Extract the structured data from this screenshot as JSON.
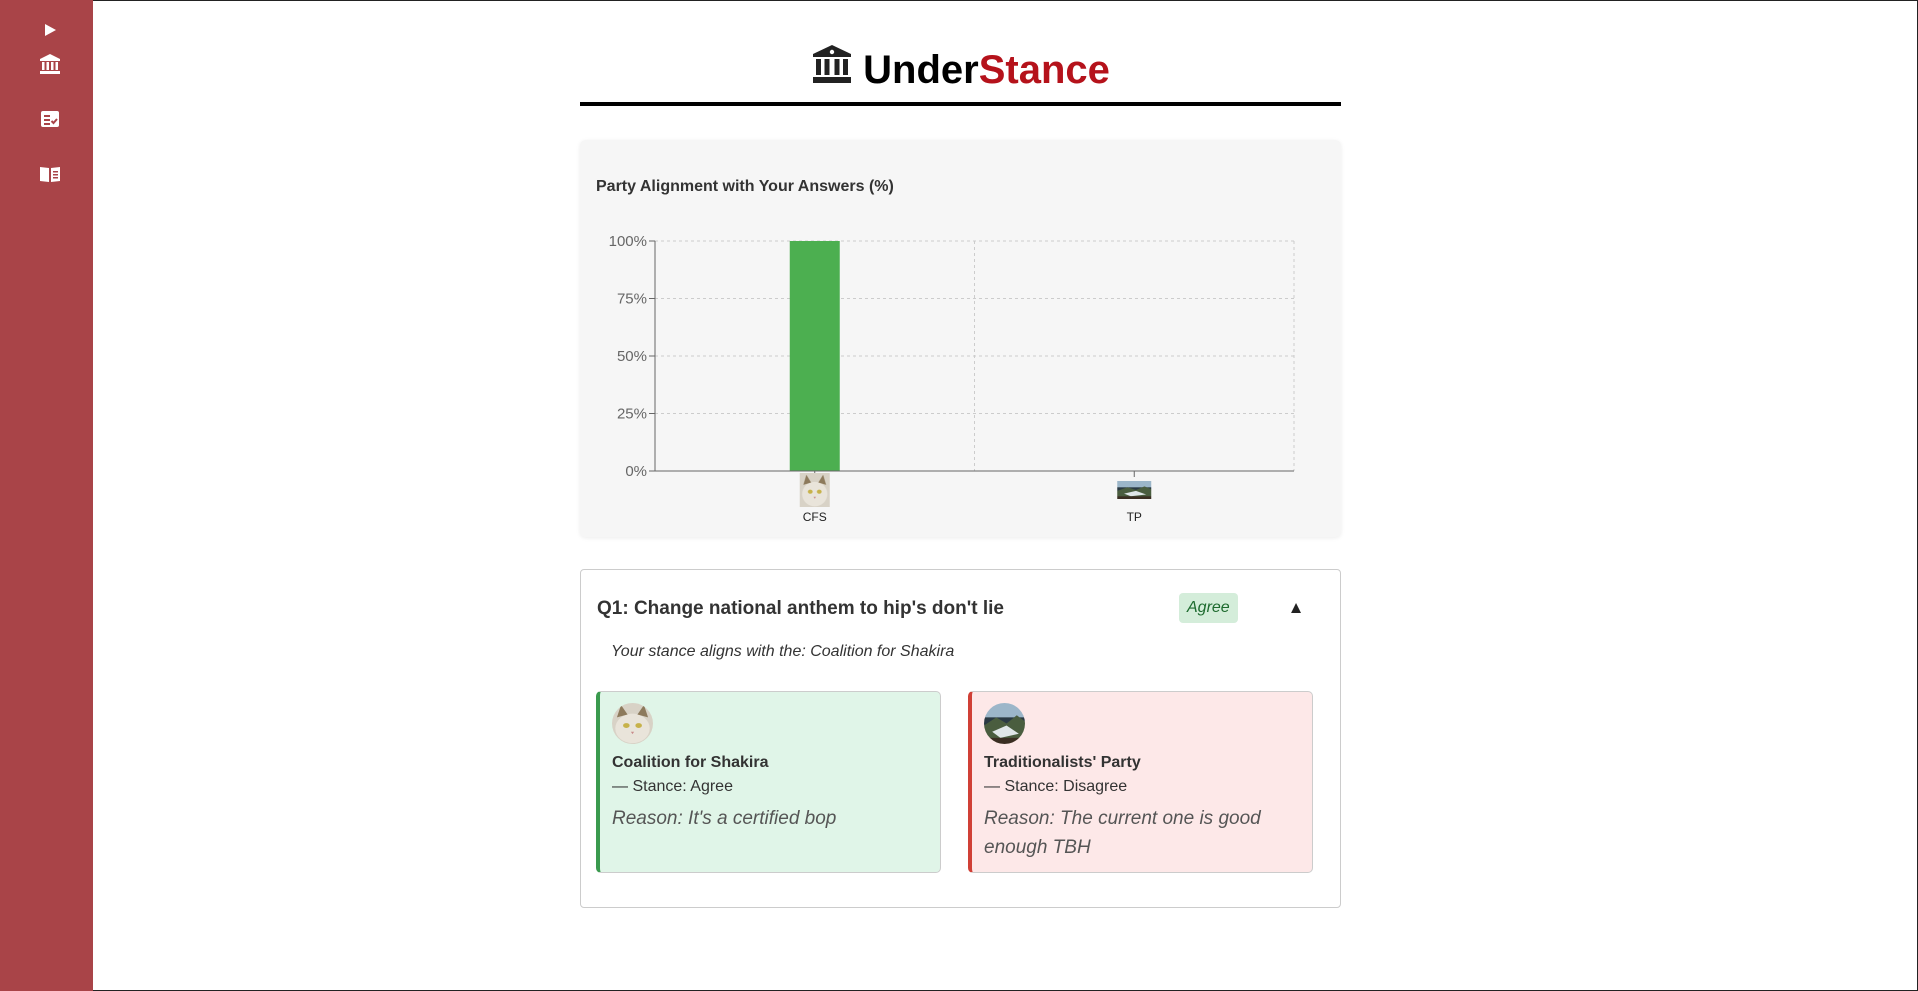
{
  "app": {
    "brand_part1": "Under",
    "brand_part2": "Stance",
    "logo_icon": "landmark-icon",
    "brand_colors": {
      "part1": "#000000",
      "part2": "#b5121b",
      "sidebar": "#a94448"
    }
  },
  "sidebar": {
    "items": [
      {
        "icon": "expand-arrow-icon"
      },
      {
        "icon": "landmark-icon"
      },
      {
        "icon": "checklist-icon"
      },
      {
        "icon": "open-book-icon"
      }
    ]
  },
  "chart_data": {
    "type": "bar",
    "title": "Party Alignment with Your Answers (%)",
    "categories": [
      "CFS",
      "TP"
    ],
    "values": [
      100,
      0
    ],
    "ylim": [
      0,
      100
    ],
    "yticks": [
      "0%",
      "25%",
      "50%",
      "75%",
      "100%"
    ],
    "grid": true,
    "bar_color": "#4caf50",
    "category_icons": [
      "cat-avatar-icon",
      "landscape-avatar-icon"
    ]
  },
  "question": {
    "title": "Q1: Change national anthem to hip's don't lie",
    "answer": "Agree",
    "toggle": "▲",
    "alignment": "Your stance aligns with the: Coalition for Shakira",
    "parties": [
      {
        "name": "Coalition for Shakira",
        "stance": "— Stance: Agree",
        "reason": "Reason: It's a certified bop",
        "avatar_icon": "cat-avatar-icon",
        "accent": "#3a9a4e"
      },
      {
        "name": "Traditionalists' Party",
        "stance": "— Stance: Disagree",
        "reason": "Reason: The current one is good enough TBH",
        "avatar_icon": "landscape-avatar-icon",
        "accent": "#d04036"
      }
    ]
  }
}
